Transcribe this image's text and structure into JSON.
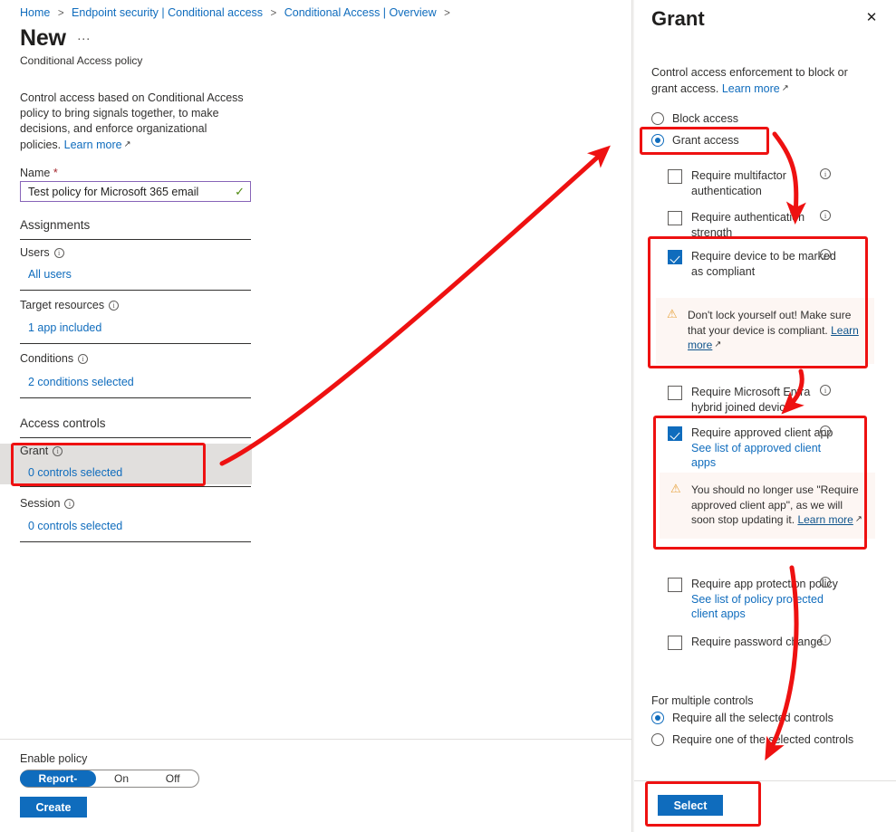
{
  "breadcrumb": {
    "items": [
      "Home",
      "Endpoint security | Conditional access",
      "Conditional Access | Overview"
    ],
    "separator": ">"
  },
  "left_blade": {
    "title": "New",
    "ellipsis": "···",
    "subtitle": "Conditional Access policy",
    "intro_text": "Control access based on Conditional Access policy to bring signals together, to make decisions, and enforce organizational policies.",
    "intro_link": "Learn more",
    "external_icon": "↗",
    "name_label": "Name",
    "name_required_mark": "*",
    "name_value": "Test policy for Microsoft 365 email",
    "name_placeholder": "Name",
    "name_valid_icon": "✓",
    "assignments_heading": "Assignments",
    "fields": [
      {
        "label": "Users",
        "value": "All users"
      },
      {
        "label": "Target resources",
        "value": "1 app included"
      },
      {
        "label": "Conditions",
        "value": "2 conditions selected"
      }
    ],
    "access_controls_heading": "Access controls",
    "access_fields": [
      {
        "label": "Grant",
        "value": "0 controls selected"
      },
      {
        "label": "Session",
        "value": "0 controls selected"
      }
    ],
    "info_icon": "i",
    "footer": {
      "enable_label": "Enable policy",
      "toggle_options": [
        "Report-only",
        "On",
        "Off"
      ],
      "toggle_selected": "Report-only",
      "create_label": "Create"
    }
  },
  "right_panel": {
    "title": "Grant",
    "close_icon": "✕",
    "description": "Control access enforcement to block or grant access.",
    "description_link": "Learn more",
    "external_icon": "↗",
    "access_mode": {
      "options": [
        "Block access",
        "Grant access"
      ],
      "selected": "Grant access"
    },
    "controls": [
      {
        "label": "Require multifactor authentication",
        "checked": false,
        "sublink": null,
        "warning": null
      },
      {
        "label": "Require authentication strength",
        "checked": false,
        "sublink": null,
        "warning": null
      },
      {
        "label": "Require device to be marked as compliant",
        "checked": true,
        "sublink": null,
        "warning": {
          "icon": "⚠",
          "text": "Don't lock yourself out! Make sure that your device is compliant.",
          "link": "Learn more"
        }
      },
      {
        "label": "Require Microsoft Entra hybrid joined device",
        "checked": false,
        "sublink": null,
        "warning": null
      },
      {
        "label": "Require approved client app",
        "checked": true,
        "sublink": "See list of approved client apps",
        "warning": {
          "icon": "⚠",
          "text": "You should no longer use \"Require approved client app\", as we will soon stop updating it.",
          "link": "Learn more"
        }
      },
      {
        "label": "Require app protection policy",
        "checked": false,
        "sublink": "See list of policy protected client apps",
        "warning": null
      },
      {
        "label": "Require password change",
        "checked": false,
        "sublink": null,
        "warning": null
      }
    ],
    "multiple_controls": {
      "label": "For multiple controls",
      "options": [
        "Require all the selected controls",
        "Require one of the selected controls"
      ],
      "selected": "Require all the selected controls"
    },
    "select_label": "Select"
  },
  "annotations": {
    "color": "#ee1111",
    "boxes": [
      {
        "name": "grant-field-highlight"
      },
      {
        "name": "grant-access-radio-highlight"
      },
      {
        "name": "require-compliant-device-highlight"
      },
      {
        "name": "require-approved-client-app-highlight"
      },
      {
        "name": "select-button-highlight"
      }
    ],
    "arrows": [
      {
        "name": "grant-field-to-panel-arrow"
      },
      {
        "name": "grant-access-to-compliant-arrow"
      },
      {
        "name": "hybrid-to-approved-app-arrow"
      },
      {
        "name": "controls-to-select-arrow"
      }
    ]
  }
}
